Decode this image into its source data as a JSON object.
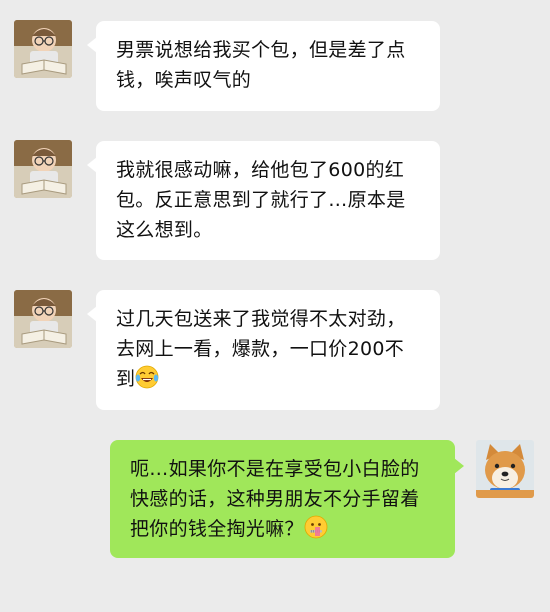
{
  "conversation": {
    "messages": [
      {
        "sender": "other",
        "avatar_icon": "baby-reading-book-avatar",
        "text": "男票说想给我买个包，但是差了点钱，唉声叹气的"
      },
      {
        "sender": "other",
        "avatar_icon": "baby-reading-book-avatar",
        "text": "我就很感动嘛，给他包了600的红包。反正意思到了就行了…原本是这么想到。"
      },
      {
        "sender": "other",
        "avatar_icon": "baby-reading-book-avatar",
        "text": "过几天包送来了我觉得不太对劲，去网上一看，爆款，一口价200不到",
        "trailing_emoji": "tears-of-joy-emoji"
      },
      {
        "sender": "self",
        "avatar_icon": "shiba-inu-dog-avatar",
        "text": "呃…如果你不是在享受包小白脸的快感的话，这种男朋友不分手留着把你的钱全掏光嘛？",
        "trailing_emoji": "zipper-mouth-emoji"
      }
    ]
  },
  "colors": {
    "background": "#ebebeb",
    "incoming_bubble": "#ffffff",
    "outgoing_bubble": "#a0e75a"
  }
}
